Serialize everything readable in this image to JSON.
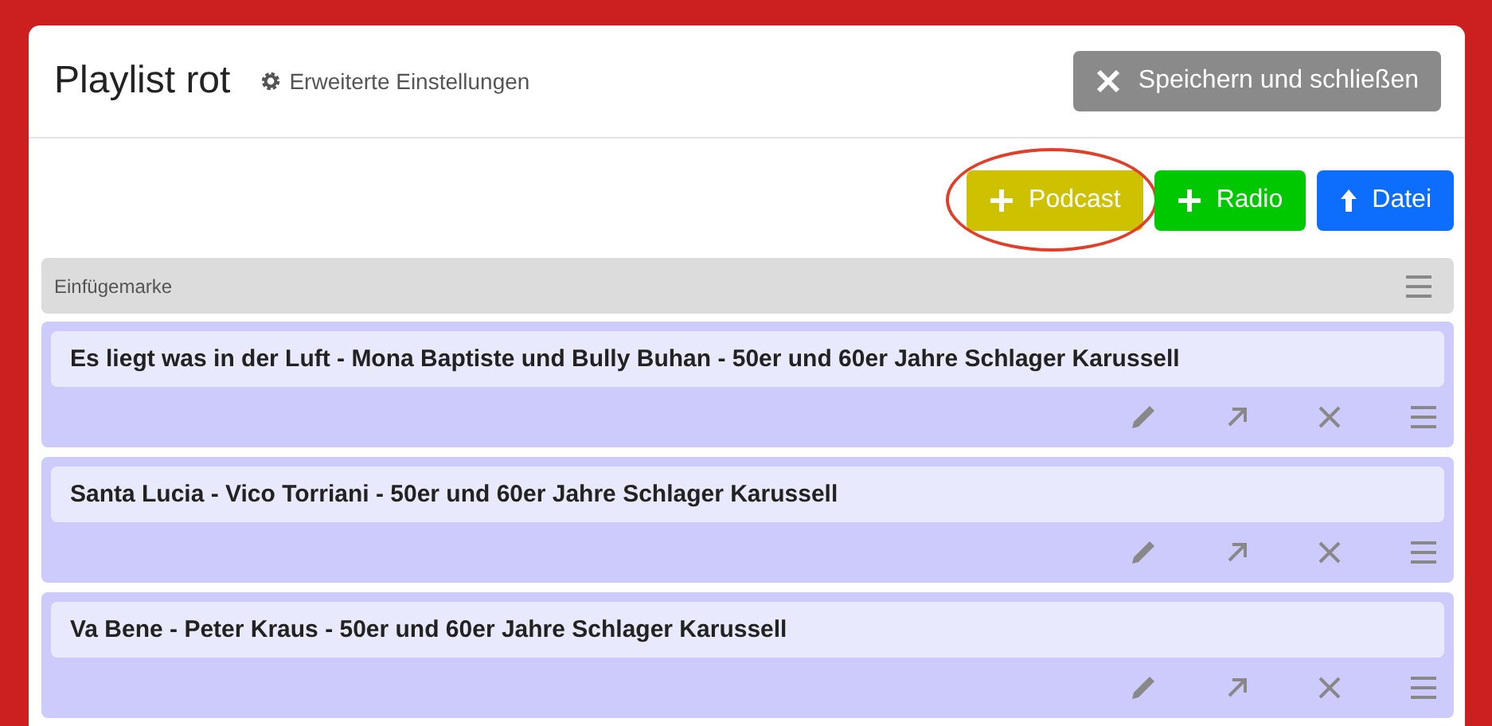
{
  "header": {
    "title": "Playlist rot",
    "settings_link": "Erweiterte Einstellungen",
    "close_button": "Speichern und schließen"
  },
  "add_buttons": [
    {
      "label": "Podcast",
      "kind": "add",
      "color": "#cdc100",
      "highlighted": true
    },
    {
      "label": "Radio",
      "kind": "add",
      "color": "#00c800",
      "highlighted": false
    },
    {
      "label": "Datei",
      "kind": "upload",
      "color": "#0d6efd",
      "highlighted": false
    }
  ],
  "insert_marker": {
    "label": "Einfügemarke"
  },
  "items": [
    {
      "title": "Es liegt was in der Luft - Mona Baptiste und Bully Buhan - 50er und 60er Jahre Schlager Karussell"
    },
    {
      "title": "Santa Lucia - Vico Torriani - 50er und 60er Jahre Schlager Karussell"
    },
    {
      "title": "Va Bene - Peter Kraus - 50er und 60er Jahre Schlager Karussell"
    }
  ]
}
